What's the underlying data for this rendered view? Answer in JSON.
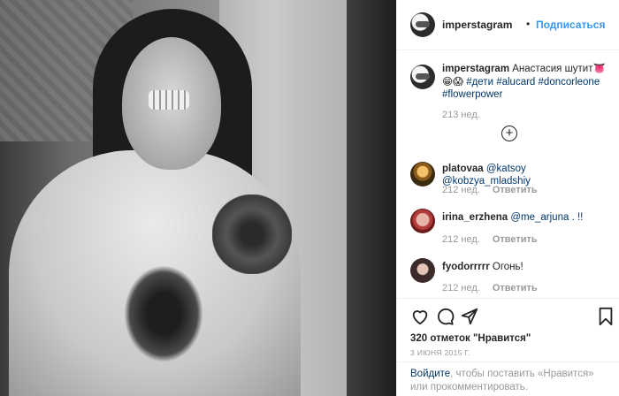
{
  "post": {
    "username": "imperstagram",
    "follow_dot": "•",
    "follow_label": "Подписаться"
  },
  "caption": {
    "username": "imperstagram",
    "text": "Анастасия шутит",
    "emojis": "👅😁😱",
    "hashtags": [
      "#дети",
      "#alucard",
      "#doncorleone",
      "#flowerpower"
    ],
    "time": "213 нед."
  },
  "load_more_icon": "plus-circle-icon",
  "comments": [
    {
      "username": "platovaa",
      "text": "@katsoy @kobzya_mladshiy",
      "time": "212 нед.",
      "reply_label": "Ответить"
    },
    {
      "username": "irina_erzhena",
      "text": "@me_arjuna . !!",
      "time": "212 нед.",
      "reply_label": "Ответить"
    },
    {
      "username": "fyodorrrrr",
      "text": "Огонь!",
      "time": "212 нед.",
      "reply_label": "Ответить"
    }
  ],
  "actions": {
    "icons": [
      "heart-icon",
      "comment-icon",
      "share-icon",
      "bookmark-icon"
    ],
    "likes": "320 отметок \"Нравится\"",
    "date": "3 ИЮНЯ 2015 Г."
  },
  "login_prompt": {
    "link": "Войдите",
    "text": ", чтобы поставить «Нравится» или прокомментировать."
  },
  "colors": {
    "accent": "#3897f0",
    "link": "#003569",
    "muted": "#999999",
    "text": "#262626",
    "border": "#efefef"
  }
}
